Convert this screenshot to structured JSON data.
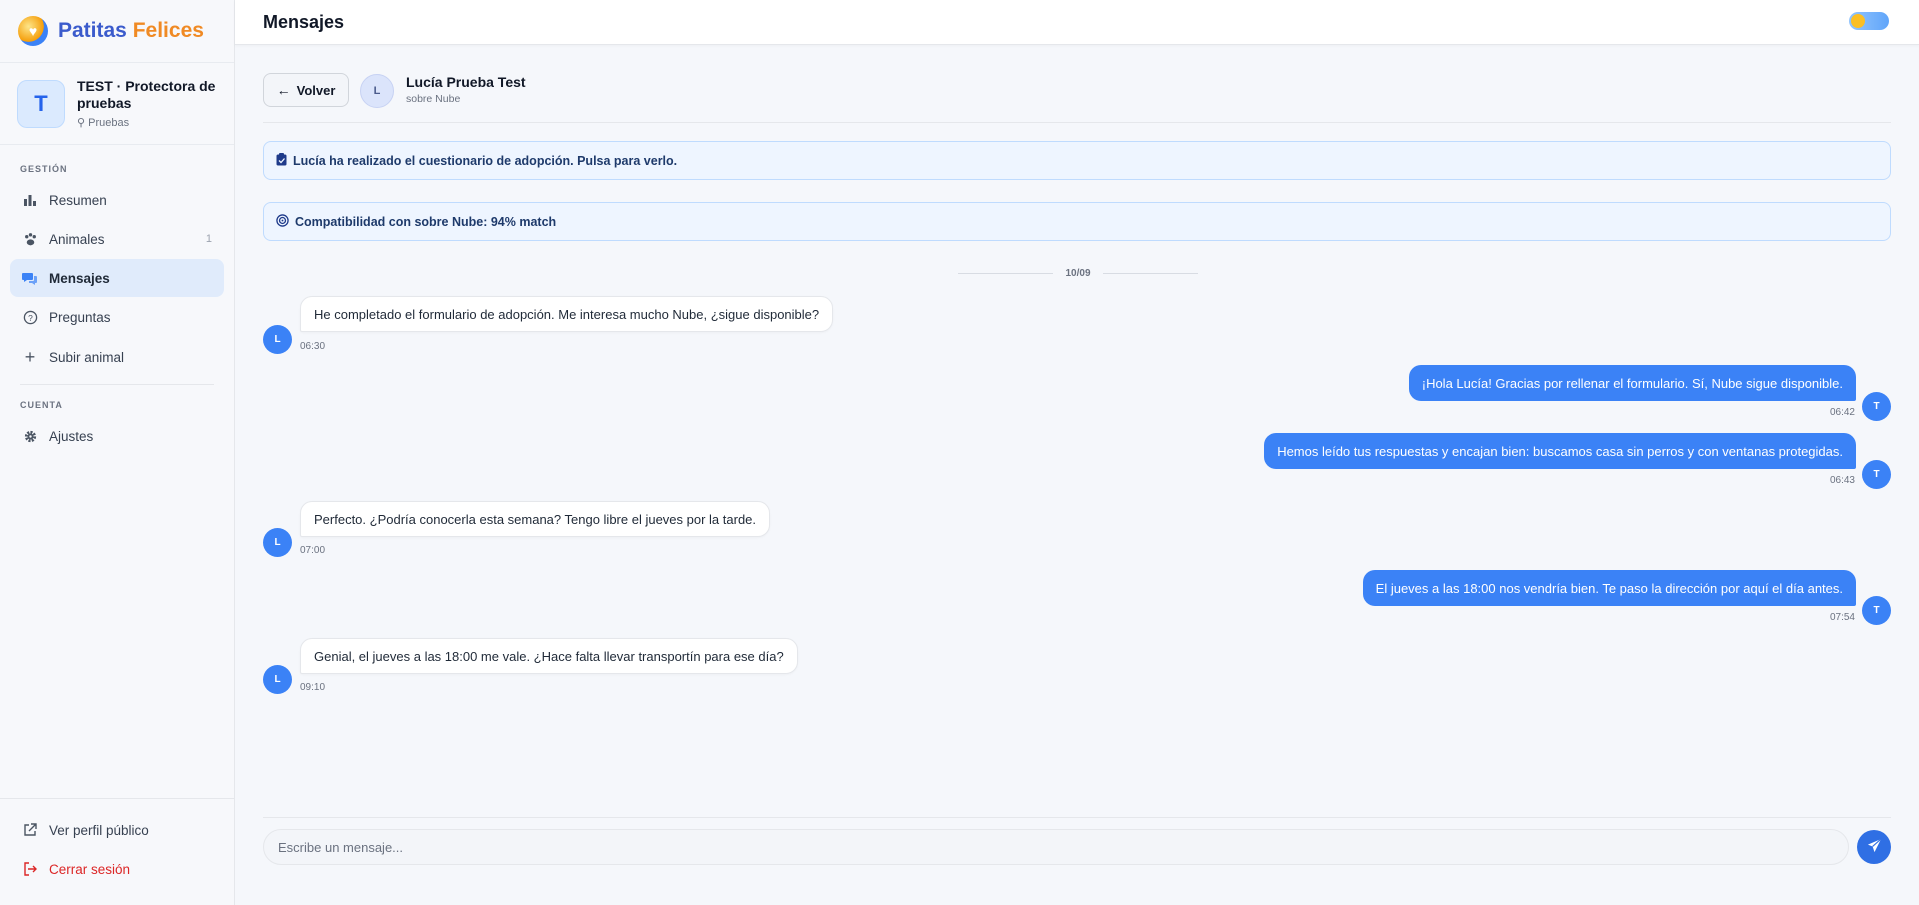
{
  "brand": {
    "name_part1": "Patitas",
    "name_part2": "Felices"
  },
  "organization": {
    "initial": "T",
    "name": "TEST · Protectora de pruebas",
    "location": "Pruebas"
  },
  "sidebar": {
    "section_gestion": "GESTIÓN",
    "section_cuenta": "CUENTA",
    "items": [
      {
        "label": "Resumen",
        "icon": "bar-chart-icon"
      },
      {
        "label": "Animales",
        "icon": "paw-icon",
        "count": "1"
      },
      {
        "label": "Mensajes",
        "icon": "chat-icon",
        "active": true
      },
      {
        "label": "Preguntas",
        "icon": "question-icon"
      },
      {
        "label": "Subir animal",
        "icon": "plus-icon"
      }
    ],
    "settings_label": "Ajustes",
    "public_profile_label": "Ver perfil público",
    "logout_label": "Cerrar sesión"
  },
  "topbar": {
    "title": "Mensajes"
  },
  "chat": {
    "back_label": "Volver",
    "contact_initial": "L",
    "contact_name": "Lucía Prueba Test",
    "contact_subtitle": "sobre Nube",
    "banner_questionnaire": "Lucía ha realizado el cuestionario de adopción. Pulsa para verlo.",
    "banner_compatibility": "Compatibilidad con sobre Nube: 94% match",
    "date_separator": "10/09",
    "messages": [
      {
        "from": "L",
        "text": "He completado el formulario de adopción. Me interesa mucho Nube, ¿sigue disponible?",
        "time": "06:30"
      },
      {
        "from": "T",
        "text": "¡Hola Lucía! Gracias por rellenar el formulario. Sí, Nube sigue disponible.",
        "time": "06:42"
      },
      {
        "from": "T",
        "text": "Hemos leído tus respuestas y encajan bien: buscamos casa sin perros y con ventanas protegidas.",
        "time": "06:43"
      },
      {
        "from": "L",
        "text": "Perfecto. ¿Podría conocerla esta semana? Tengo libre el jueves por la tarde.",
        "time": "07:00"
      },
      {
        "from": "T",
        "text": "El jueves a las 18:00 nos vendría bien. Te paso la dirección por aquí el día antes.",
        "time": "07:54"
      },
      {
        "from": "L",
        "text": "Genial, el jueves a las 18:00 me vale. ¿Hace falta llevar transportín para ese día?",
        "time": "09:10"
      }
    ],
    "composer_placeholder": "Escribe un mensaje..."
  },
  "colors": {
    "accent": "#3b82f6",
    "brand_blue": "#3b5bcc",
    "brand_orange": "#f08a24",
    "danger": "#dc2626"
  }
}
